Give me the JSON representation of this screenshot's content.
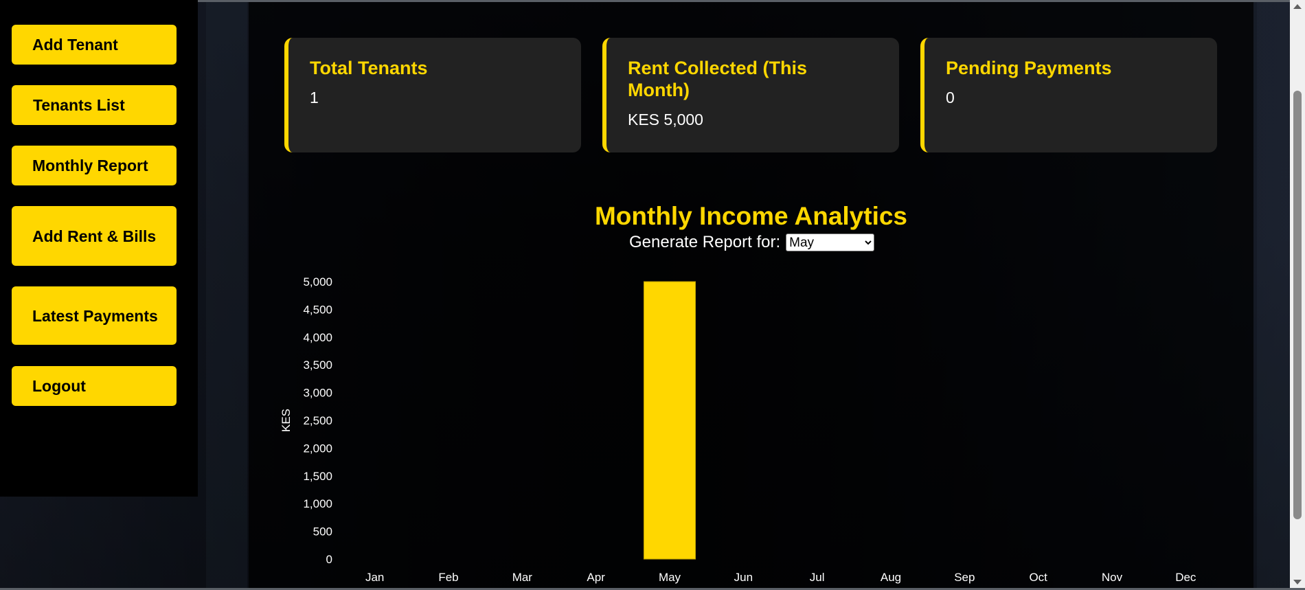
{
  "sidebar": {
    "items": [
      {
        "label": "Add Tenant"
      },
      {
        "label": "Tenants List"
      },
      {
        "label": "Monthly Report"
      },
      {
        "label": "Add Rent & Bills"
      },
      {
        "label": "Latest Payments"
      },
      {
        "label": "Logout"
      }
    ]
  },
  "stats": [
    {
      "title": "Total Tenants",
      "value": "1"
    },
    {
      "title": "Rent Collected (This Month)",
      "value": "KES 5,000"
    },
    {
      "title": "Pending Payments",
      "value": "0"
    }
  ],
  "analytics": {
    "title": "Monthly Income Analytics",
    "report_label": "Generate Report for:",
    "selected_month": "May"
  },
  "colors": {
    "accent": "#ffd700",
    "card_bg": "#222222"
  },
  "chart_data": {
    "type": "bar",
    "categories": [
      "Jan",
      "Feb",
      "Mar",
      "Apr",
      "May",
      "Jun",
      "Jul",
      "Aug",
      "Sep",
      "Oct",
      "Nov",
      "Dec"
    ],
    "values": [
      0,
      0,
      0,
      0,
      5000,
      0,
      0,
      0,
      0,
      0,
      0,
      0
    ],
    "ylabel": "KES",
    "xlabel": "",
    "ylim": [
      0,
      5000
    ],
    "yticks": [
      "0",
      "500",
      "1,000",
      "1,500",
      "2,000",
      "2,500",
      "3,000",
      "3,500",
      "4,000",
      "4,500",
      "5,000"
    ],
    "grid": false,
    "bar_color": "#ffd700"
  }
}
